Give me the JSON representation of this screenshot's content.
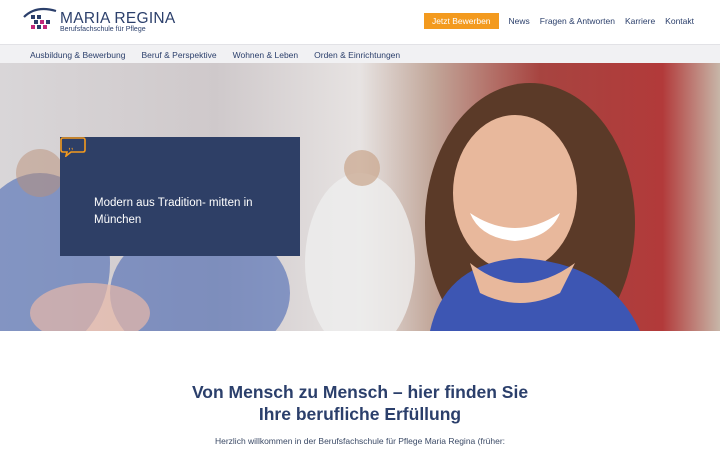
{
  "brand": {
    "title": "MARIA REGINA",
    "subtitle": "Berufsfachschule für Pflege",
    "colors": {
      "navy": "#2b3f6b",
      "accent": "#f39a1e",
      "magenta": "#c0287a"
    }
  },
  "topnav": {
    "cta_label": "Jetzt Bewerben",
    "items": [
      "News",
      "Fragen & Antworten",
      "Karriere",
      "Kontakt"
    ]
  },
  "subnav": {
    "items": [
      "Ausbildung & Bewerbung",
      "Beruf & Perspektive",
      "Wohnen & Leben",
      "Orden & Einrichtungen"
    ]
  },
  "hero": {
    "quote_icon": "speech-bubble-quote-icon",
    "quote_text": "Modern aus Tradition- mitten in München"
  },
  "main": {
    "headline_line1": "Von Mensch zu Mensch – hier finden Sie",
    "headline_line2": "Ihre berufliche Erfüllung",
    "intro": "Herzlich willkommen in der Berufsfachschule für Pflege Maria Regina (früher:"
  }
}
